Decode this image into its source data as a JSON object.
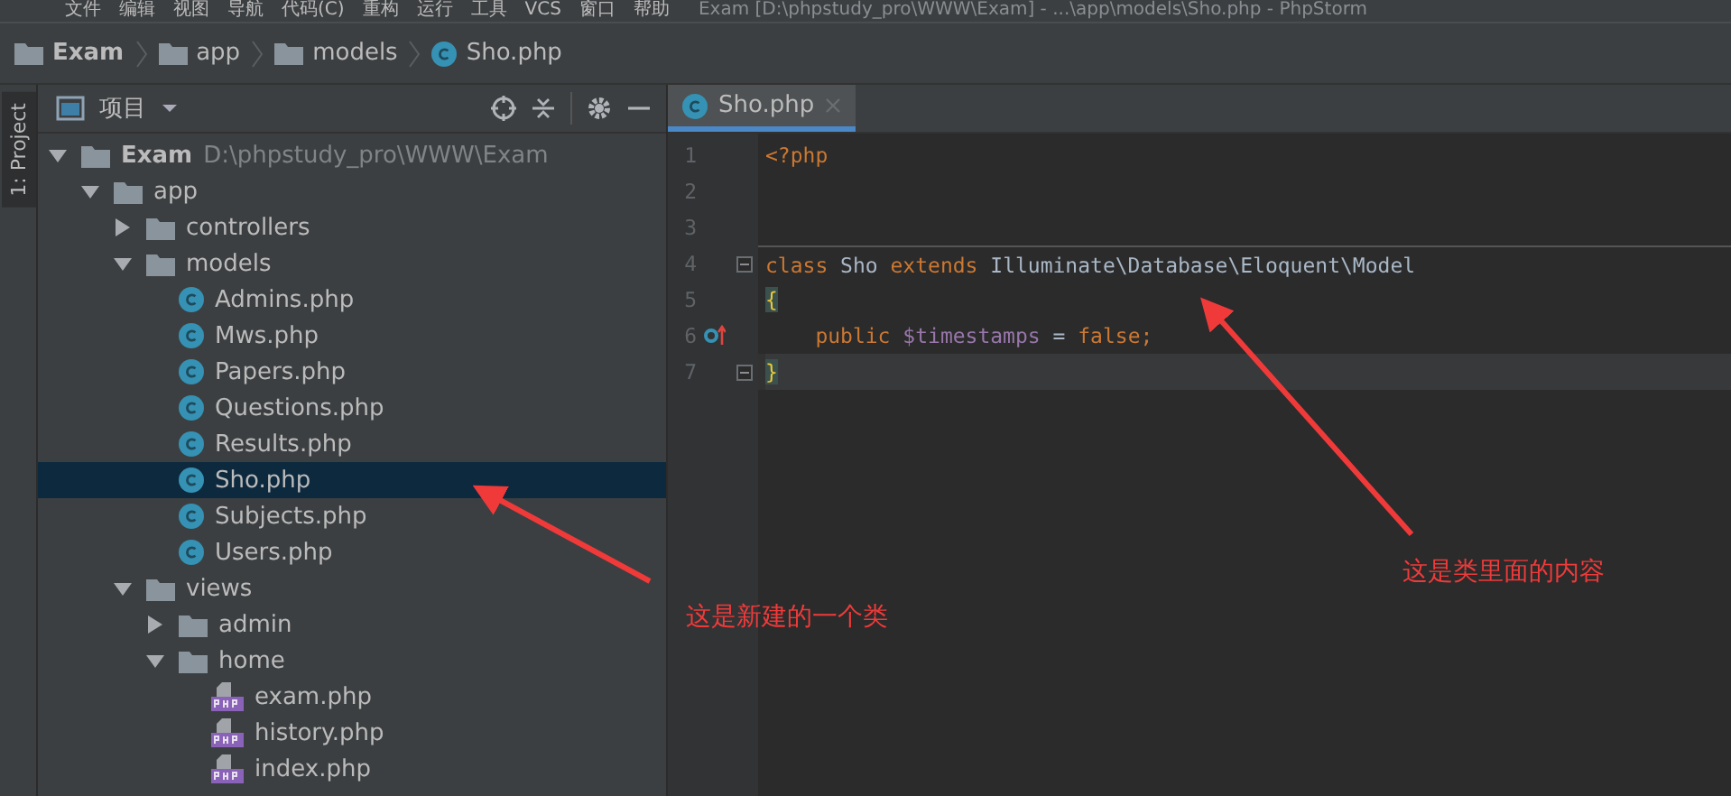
{
  "menu_bar": {
    "items": [
      "文件",
      "编辑",
      "视图",
      "导航",
      "代码(C)",
      "重构",
      "运行",
      "工具",
      "VCS",
      "窗口",
      "帮助"
    ],
    "title": "Exam [D:\\phpstudy_pro\\WWW\\Exam] - ...\\app\\models\\Sho.php - PhpStorm"
  },
  "breadcrumbs": [
    {
      "label": "Exam",
      "kind": "folder"
    },
    {
      "label": "app",
      "kind": "folder"
    },
    {
      "label": "models",
      "kind": "folder"
    },
    {
      "label": "Sho.php",
      "kind": "class"
    }
  ],
  "side_strip": {
    "tab": "1: Project"
  },
  "project_panel": {
    "title": "项目"
  },
  "tree": [
    {
      "label": "Exam",
      "path": "D:\\phpstudy_pro\\WWW\\Exam",
      "kind": "folder",
      "expanded": true,
      "selected": false,
      "children": [
        {
          "label": "app",
          "kind": "folder",
          "expanded": true,
          "selected": false,
          "children": [
            {
              "label": "controllers",
              "kind": "folder",
              "expanded": false,
              "selected": false
            },
            {
              "label": "models",
              "kind": "folder",
              "expanded": true,
              "selected": false,
              "children": [
                {
                  "label": "Admins.php",
                  "kind": "class",
                  "selected": false
                },
                {
                  "label": "Mws.php",
                  "kind": "class",
                  "selected": false
                },
                {
                  "label": "Papers.php",
                  "kind": "class",
                  "selected": false
                },
                {
                  "label": "Questions.php",
                  "kind": "class",
                  "selected": false
                },
                {
                  "label": "Results.php",
                  "kind": "class",
                  "selected": false
                },
                {
                  "label": "Sho.php",
                  "kind": "class",
                  "selected": true
                },
                {
                  "label": "Subjects.php",
                  "kind": "class",
                  "selected": false
                },
                {
                  "label": "Users.php",
                  "kind": "class",
                  "selected": false
                }
              ]
            },
            {
              "label": "views",
              "kind": "folder",
              "expanded": true,
              "selected": false,
              "children": [
                {
                  "label": "admin",
                  "kind": "folder",
                  "expanded": false,
                  "selected": false
                },
                {
                  "label": "home",
                  "kind": "folder",
                  "expanded": true,
                  "selected": false,
                  "children": [
                    {
                      "label": "exam.php",
                      "kind": "php",
                      "selected": false
                    },
                    {
                      "label": "history.php",
                      "kind": "php",
                      "selected": false
                    },
                    {
                      "label": "index.php",
                      "kind": "php",
                      "selected": false
                    }
                  ]
                }
              ]
            }
          ]
        }
      ]
    }
  ],
  "editor_tabs": [
    {
      "label": "Sho.php",
      "selected": true
    }
  ],
  "code_lines": [
    {
      "number": "1",
      "tokens": [
        {
          "text": "<?php",
          "kind": "keyword"
        }
      ]
    },
    {
      "number": "2"
    },
    {
      "number": "3"
    },
    {
      "number": "4",
      "fold": true,
      "separator": true,
      "tokens": [
        {
          "text": "class",
          "kind": "keyword"
        },
        {
          "text": " Sho ",
          "kind": "plain"
        },
        {
          "text": "extends",
          "kind": "keyword"
        },
        {
          "text": " Illuminate\\Database\\Eloquent\\Model",
          "kind": "plain"
        }
      ]
    },
    {
      "number": "5",
      "tokens": [
        {
          "text": "{",
          "kind": "brace"
        }
      ]
    },
    {
      "number": "6",
      "override": true,
      "tokens": [
        {
          "text": "    public",
          "kind": "keyword"
        },
        {
          "text": " $timestamps",
          "kind": "variable"
        },
        {
          "text": " = ",
          "kind": "plain"
        },
        {
          "text": "false",
          "kind": "keyword"
        },
        {
          "text": ";",
          "kind": "keyword"
        }
      ]
    },
    {
      "number": "7",
      "fold": true,
      "current": true,
      "tokens": [
        {
          "text": "}",
          "kind": "brace"
        }
      ]
    }
  ],
  "annotations": [
    {
      "text": "这是新建的一个类"
    },
    {
      "text": "这是类里面的内容"
    }
  ]
}
